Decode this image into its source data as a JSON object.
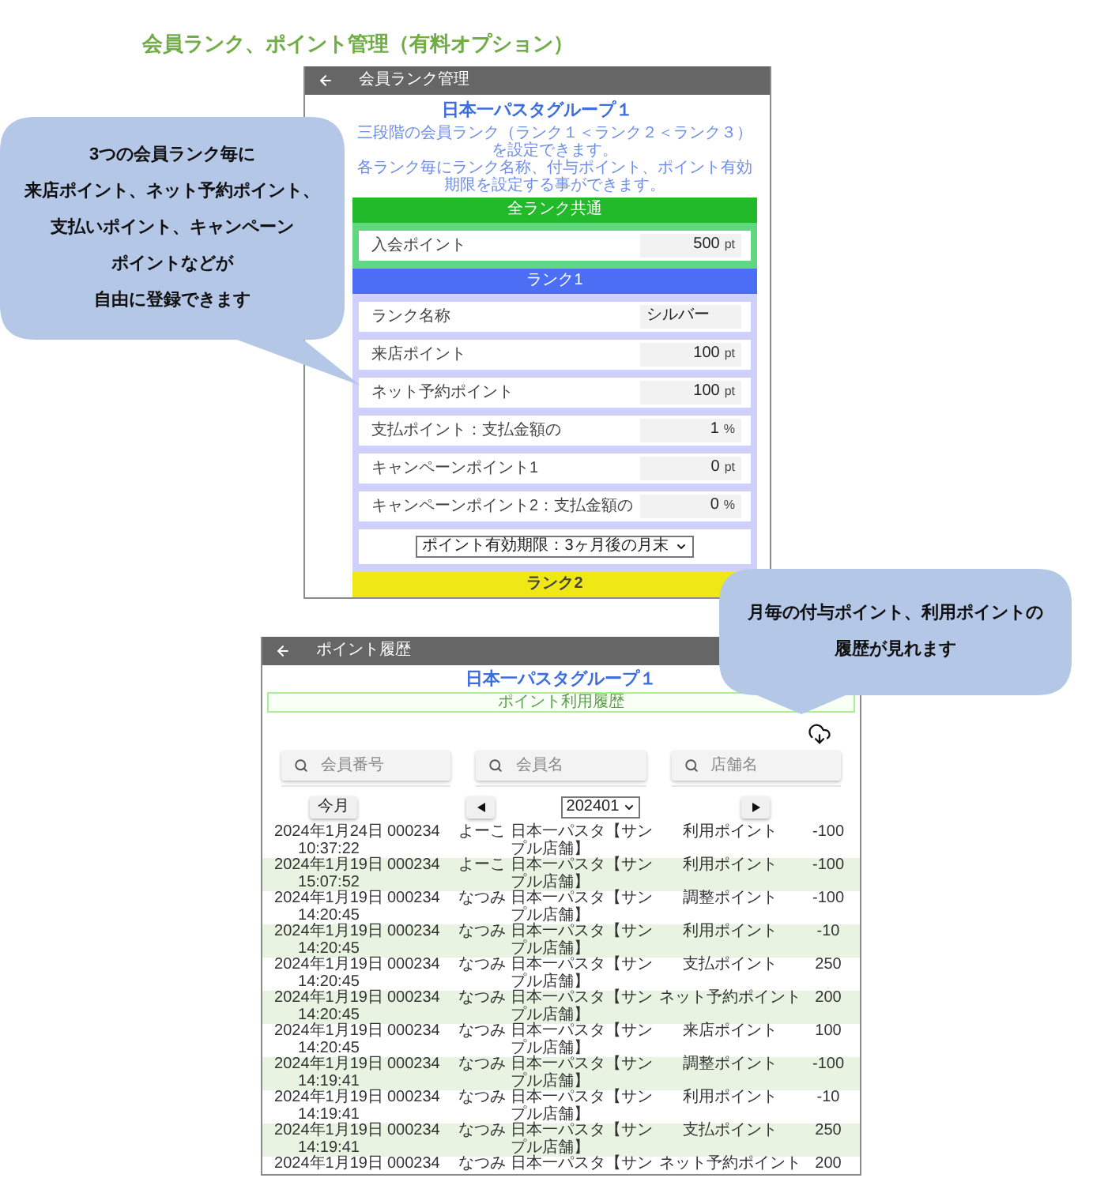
{
  "page_title": "会員ランク、ポイント管理（有料オプション）",
  "rank_screen": {
    "header": {
      "title": "会員ランク管理"
    },
    "group_name": "日本一パスタグループ１",
    "description": [
      "三段階の会員ランク（ランク１＜ランク２＜ランク３）を設定できます。",
      "各ランク毎にランク名称、付与ポイント、ポイント有効期限を設定する事ができます。"
    ],
    "sections": [
      {
        "title": "全ランク共通",
        "kind": "common",
        "color": "#22b92a",
        "rows": [
          {
            "kind": "number",
            "label": "入会ポイント",
            "value": "500",
            "unit": "pt"
          }
        ]
      },
      {
        "title": "ランク1",
        "kind": "rank",
        "color": "#4c6ef5",
        "rows": [
          {
            "kind": "text",
            "label": "ランク名称",
            "value": "シルバー"
          },
          {
            "kind": "number",
            "label": "来店ポイント",
            "value": "100",
            "unit": "pt"
          },
          {
            "kind": "number",
            "label": "ネット予約ポイント",
            "value": "100",
            "unit": "pt"
          },
          {
            "kind": "number",
            "label": "支払ポイント：支払金額の",
            "value": "1",
            "unit": "%"
          },
          {
            "kind": "number",
            "label": "キャンペーンポイント1",
            "value": "0",
            "unit": "pt"
          },
          {
            "kind": "number",
            "label": "キャンペーンポイント2：支払金額の",
            "value": "0",
            "unit": "%"
          },
          {
            "kind": "select",
            "value": "ポイント有効期限：3ヶ月後の月末"
          }
        ]
      },
      {
        "title": "ランク2",
        "color": "#efe815"
      }
    ]
  },
  "history_screen": {
    "header": {
      "title": "ポイント履歴"
    },
    "group_name": "日本一パスタグループ１",
    "banner": "ポイント利用履歴",
    "search_fields": [
      {
        "placeholder": "会員番号"
      },
      {
        "placeholder": "会員名"
      },
      {
        "placeholder": "店舗名"
      }
    ],
    "month_nav": {
      "this_month_button": "今月",
      "month": "202401"
    },
    "rows": [
      {
        "date": "2024年1月24日",
        "time": "10:37:22",
        "member_number": "000234",
        "member_name": "よーこ",
        "store": "日本一パスタ【サンプル店舗】",
        "point_type": "利用ポイント",
        "points": "-100"
      },
      {
        "date": "2024年1月19日",
        "time": "15:07:52",
        "member_number": "000234",
        "member_name": "よーこ",
        "store": "日本一パスタ【サンプル店舗】",
        "point_type": "利用ポイント",
        "points": "-100"
      },
      {
        "date": "2024年1月19日",
        "time": "14:20:45",
        "member_number": "000234",
        "member_name": "なつみ",
        "store": "日本一パスタ【サンプル店舗】",
        "point_type": "調整ポイント",
        "points": "-100"
      },
      {
        "date": "2024年1月19日",
        "time": "14:20:45",
        "member_number": "000234",
        "member_name": "なつみ",
        "store": "日本一パスタ【サンプル店舗】",
        "point_type": "利用ポイント",
        "points": "-10"
      },
      {
        "date": "2024年1月19日",
        "time": "14:20:45",
        "member_number": "000234",
        "member_name": "なつみ",
        "store": "日本一パスタ【サンプル店舗】",
        "point_type": "支払ポイント",
        "points": "250"
      },
      {
        "date": "2024年1月19日",
        "time": "14:20:45",
        "member_number": "000234",
        "member_name": "なつみ",
        "store": "日本一パスタ【サンプル店舗】",
        "point_type": "ネット予約ポイント",
        "points": "200"
      },
      {
        "date": "2024年1月19日",
        "time": "14:20:45",
        "member_number": "000234",
        "member_name": "なつみ",
        "store": "日本一パスタ【サンプル店舗】",
        "point_type": "来店ポイント",
        "points": "100"
      },
      {
        "date": "2024年1月19日",
        "time": "14:19:41",
        "member_number": "000234",
        "member_name": "なつみ",
        "store": "日本一パスタ【サンプル店舗】",
        "point_type": "調整ポイント",
        "points": "-100"
      },
      {
        "date": "2024年1月19日",
        "time": "14:19:41",
        "member_number": "000234",
        "member_name": "なつみ",
        "store": "日本一パスタ【サンプル店舗】",
        "point_type": "利用ポイント",
        "points": "-10"
      },
      {
        "date": "2024年1月19日",
        "time": "14:19:41",
        "member_number": "000234",
        "member_name": "なつみ",
        "store": "日本一パスタ【サンプル店舗】",
        "point_type": "支払ポイント",
        "points": "250"
      },
      {
        "date": "2024年1月19日",
        "member_number": "000234",
        "member_name": "なつみ",
        "store": "日本一パスタ【サン",
        "point_type": "ネット予約ポイント",
        "points": "200"
      }
    ]
  },
  "callouts": [
    {
      "lines": [
        "3つの会員ランク毎に",
        "来店ポイント、ネット予約ポイント、",
        "支払いポイント、キャンペーン",
        "ポイントなどが",
        "自由に登録できます"
      ]
    },
    {
      "lines": [
        "月毎の付与ポイント、利用ポイントの",
        "履歴が見れます"
      ]
    }
  ]
}
